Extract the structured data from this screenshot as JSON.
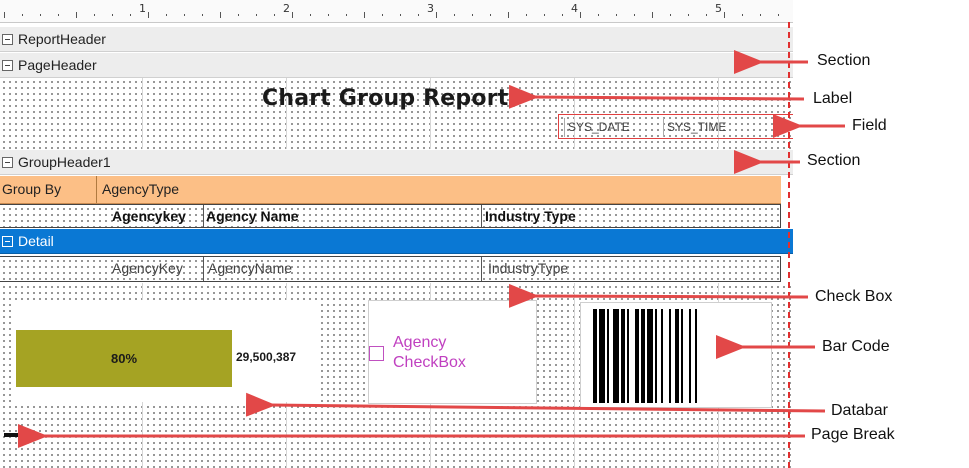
{
  "ruler": {
    "numbers": [
      "1",
      "2",
      "3",
      "4",
      "5"
    ]
  },
  "sections": {
    "report_header": "ReportHeader",
    "page_header": "PageHeader",
    "group_header": "GroupHeader1",
    "detail": "Detail"
  },
  "page_header": {
    "title": "Chart Group Report",
    "fields": [
      "SYS_DATE",
      "SYS_TIME"
    ]
  },
  "group_header": {
    "group_by_label": "Group By",
    "group_by_value": "AgencyType",
    "columns": [
      "Agencykey",
      "Agency Name",
      "Industry Type"
    ]
  },
  "detail": {
    "fields": [
      "AgencyKey",
      "AgencyName",
      "IndustryType"
    ],
    "databar": {
      "percent_label": "80%",
      "fraction": 0.8,
      "value_label": "29,500,387"
    },
    "checkbox": {
      "line1": "Agency",
      "line2": "CheckBox",
      "checked": false
    }
  },
  "annotations": {
    "section_1": "Section",
    "label": "Label",
    "field": "Field",
    "section_2": "Section",
    "check_box": "Check Box",
    "bar_code": "Bar Code",
    "databar": "Databar",
    "page_break": "Page Break"
  },
  "colors": {
    "group_row": "#fcbf86",
    "detail_section": "#0a78d4",
    "databar": "#a5a323",
    "checkbox_text": "#c040c0",
    "arrow": "#e24848"
  }
}
